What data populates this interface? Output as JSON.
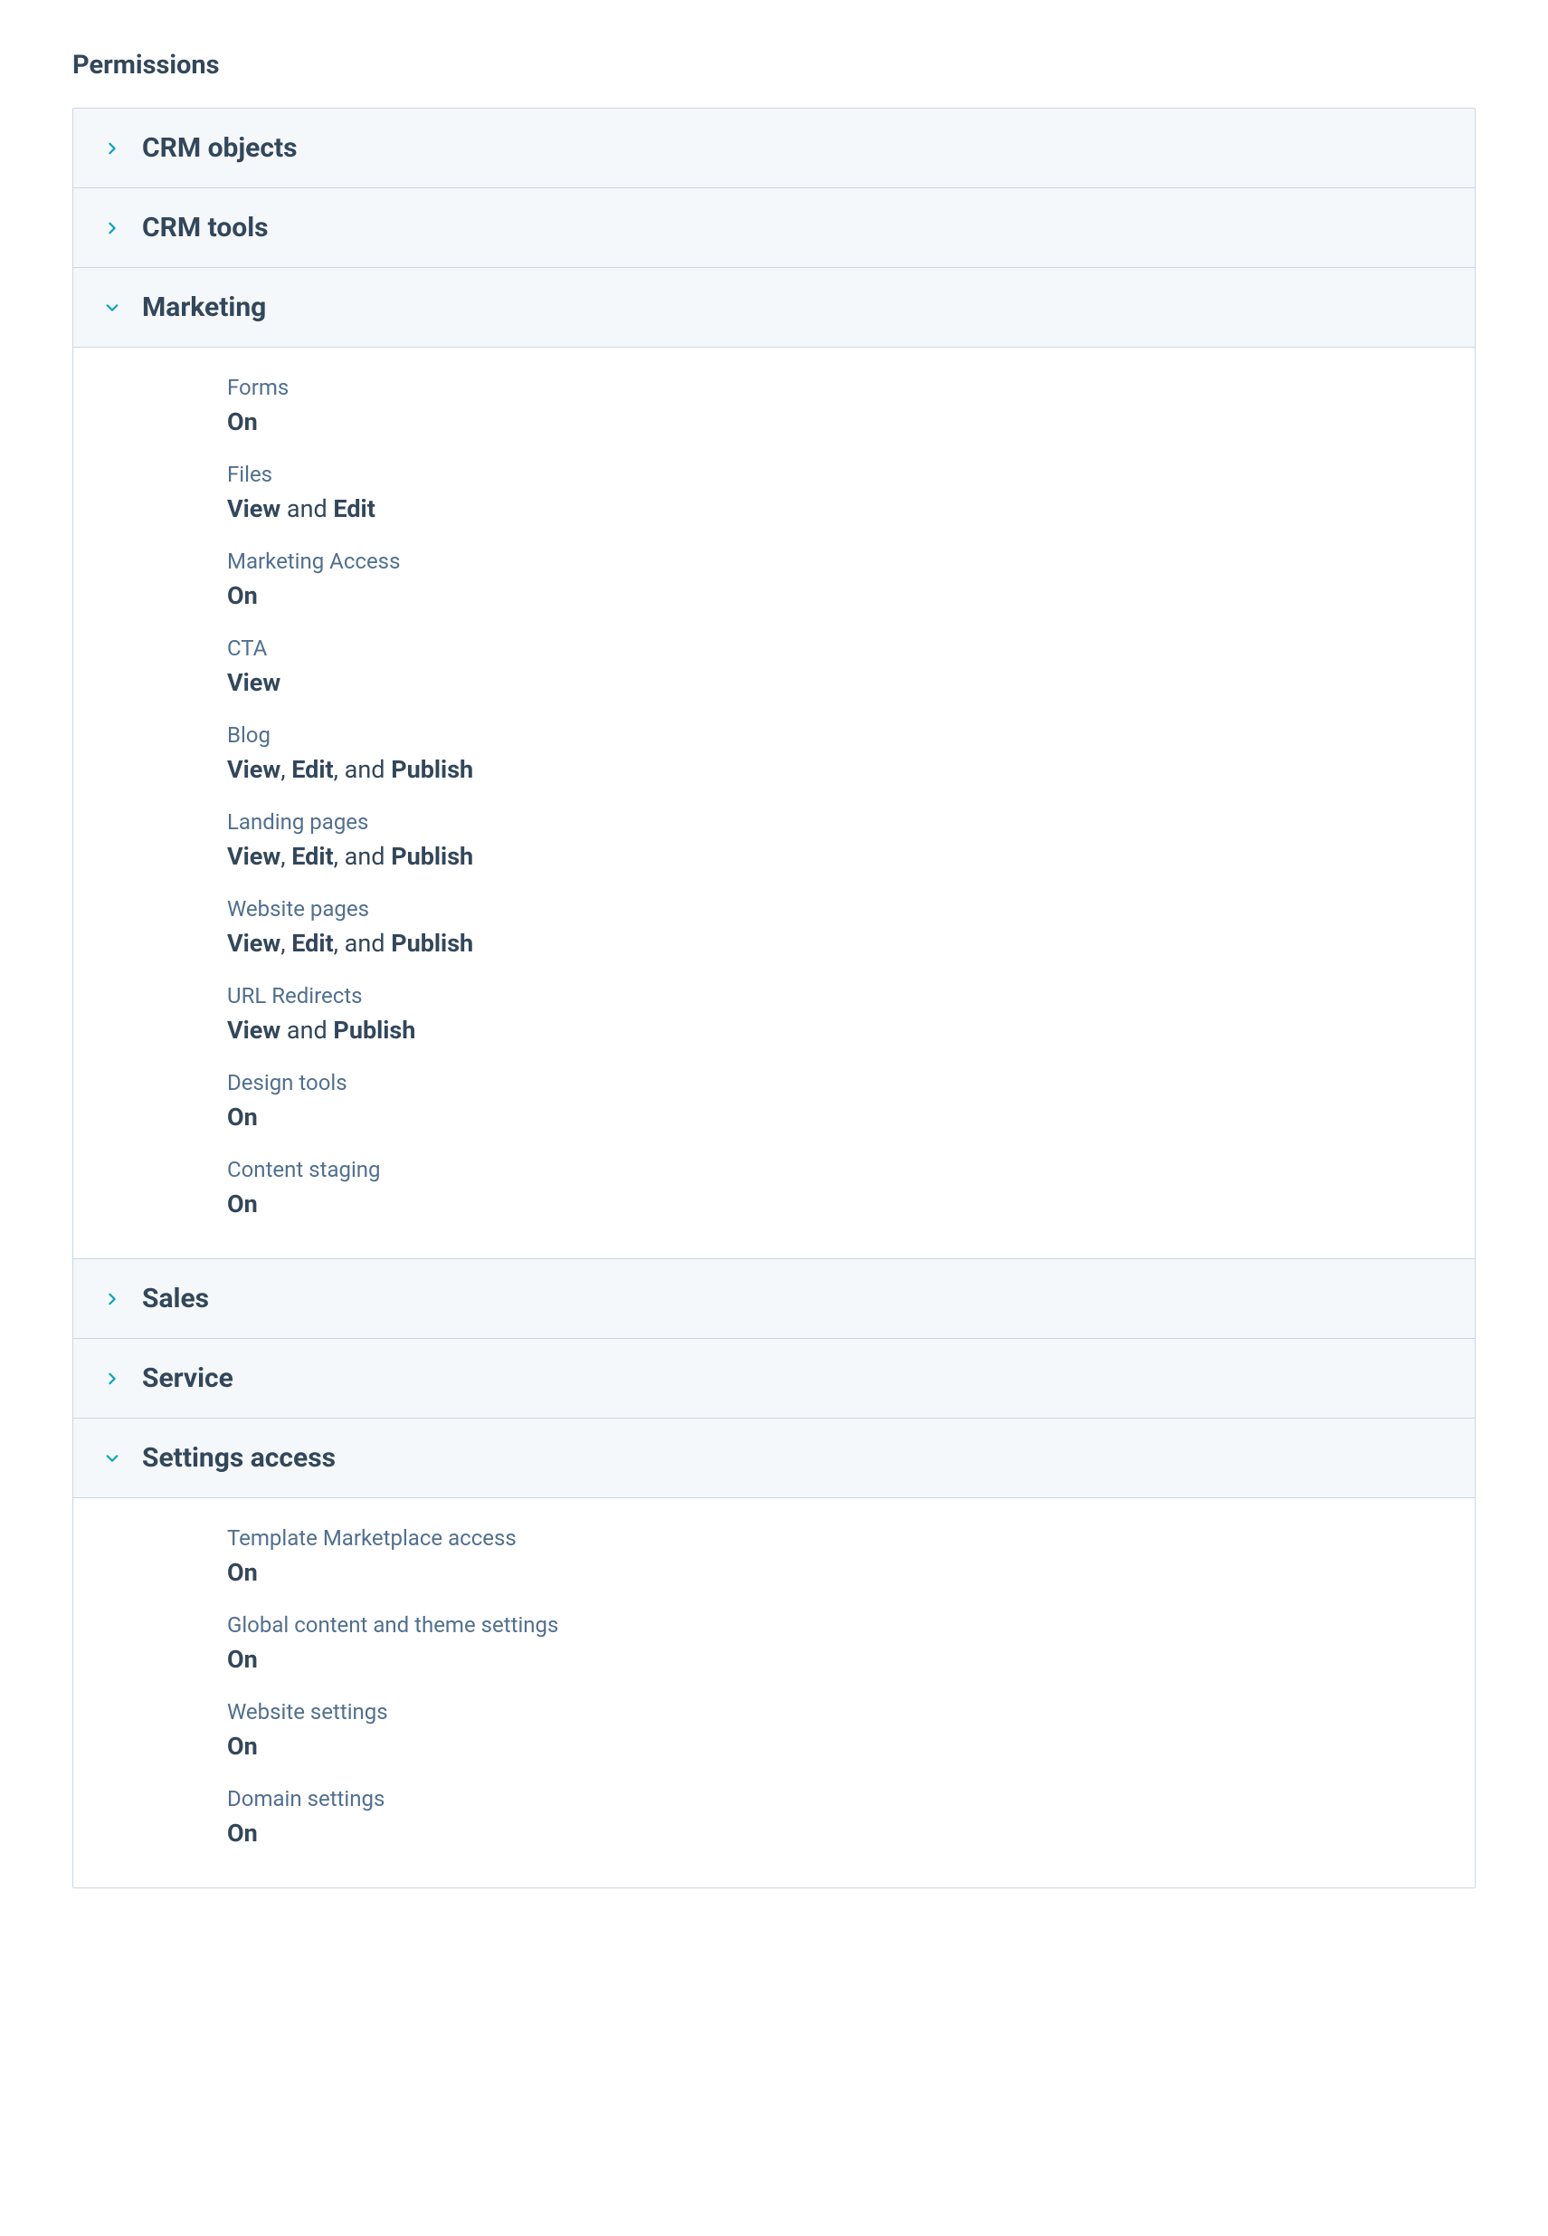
{
  "title": "Permissions",
  "sections": {
    "crm_objects": {
      "title": "CRM objects"
    },
    "crm_tools": {
      "title": "CRM tools"
    },
    "marketing": {
      "title": "Marketing"
    },
    "sales": {
      "title": "Sales"
    },
    "service": {
      "title": "Service"
    },
    "settings": {
      "title": "Settings access"
    }
  },
  "marketing_items": {
    "forms": {
      "label": "Forms",
      "parts": [
        "On"
      ]
    },
    "files": {
      "label": "Files",
      "parts": [
        "View",
        " and ",
        "Edit"
      ]
    },
    "marketing_access": {
      "label": "Marketing Access",
      "parts": [
        "On"
      ]
    },
    "cta": {
      "label": "CTA",
      "parts": [
        "View"
      ]
    },
    "blog": {
      "label": "Blog",
      "parts": [
        "View",
        ", ",
        "Edit",
        ", and ",
        "Publish"
      ]
    },
    "landing_pages": {
      "label": "Landing pages",
      "parts": [
        "View",
        ", ",
        "Edit",
        ", and ",
        "Publish"
      ]
    },
    "website_pages": {
      "label": "Website pages",
      "parts": [
        "View",
        ", ",
        "Edit",
        ", and ",
        "Publish"
      ]
    },
    "url_redirects": {
      "label": "URL Redirects",
      "parts": [
        "View",
        " and ",
        "Publish"
      ]
    },
    "design_tools": {
      "label": "Design tools",
      "parts": [
        "On"
      ]
    },
    "content_staging": {
      "label": "Content staging",
      "parts": [
        "On"
      ]
    }
  },
  "settings_items": {
    "template_marketplace": {
      "label": "Template Marketplace access",
      "parts": [
        "On"
      ]
    },
    "global_content": {
      "label": "Global content and theme settings",
      "parts": [
        "On"
      ]
    },
    "website_settings": {
      "label": "Website settings",
      "parts": [
        "On"
      ]
    },
    "domain_settings": {
      "label": "Domain settings",
      "parts": [
        "On"
      ]
    }
  }
}
